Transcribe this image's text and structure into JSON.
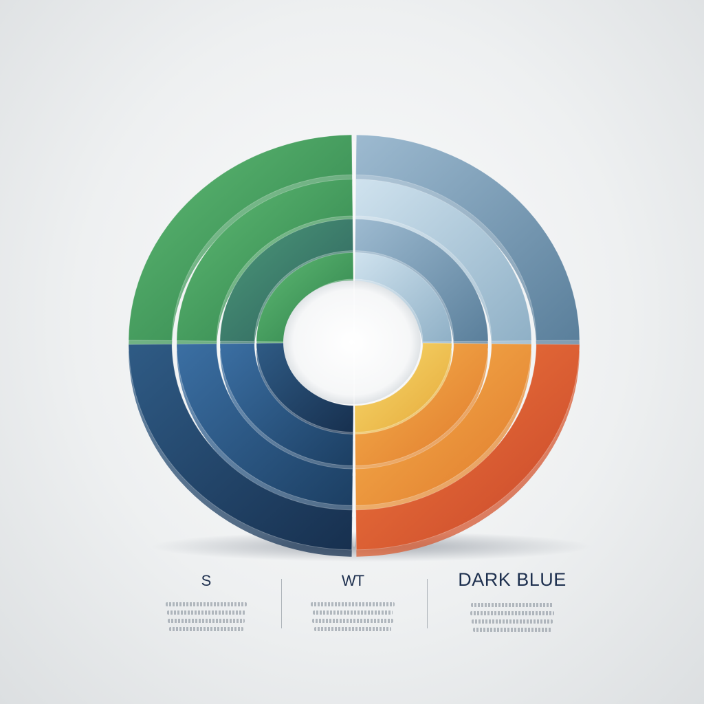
{
  "legend": {
    "items": [
      {
        "title": "S"
      },
      {
        "title": "WT"
      },
      {
        "title": "DARK BLUE"
      }
    ]
  },
  "colors": {
    "green": "#3e9a56",
    "teal_green": "#3f7f6a",
    "light_blue": "#a9c6d8",
    "steel_blue": "#6f93ad",
    "dark_blue": "#27527e",
    "navy": "#1f3f63",
    "yellow": "#f0c44a",
    "orange": "#ee9a36",
    "red_orange": "#e46030",
    "text": "#1d2f4e"
  }
}
